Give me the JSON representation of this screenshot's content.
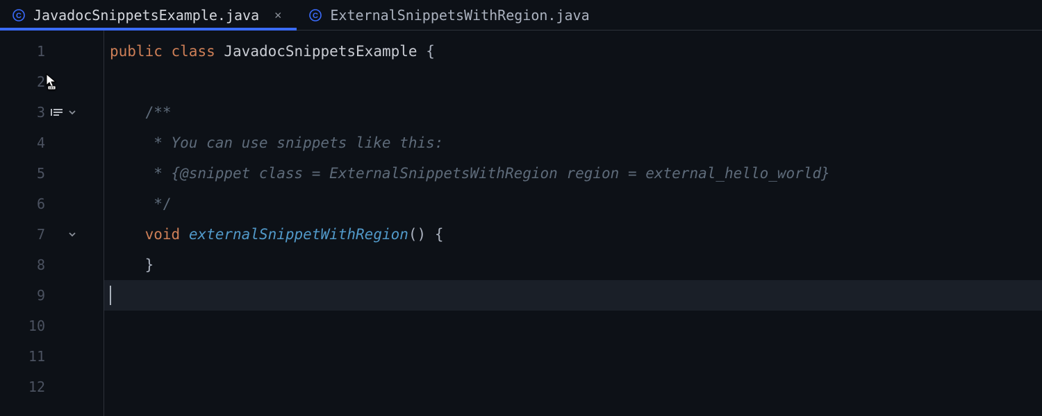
{
  "tabs": [
    {
      "label": "JavadocSnippetsExample.java",
      "active": true,
      "closable": true
    },
    {
      "label": "ExternalSnippetsWithRegion.java",
      "active": false,
      "closable": false
    }
  ],
  "gutter": {
    "lines": [
      "1",
      "2",
      "3",
      "4",
      "5",
      "6",
      "7",
      "8",
      "9",
      "10",
      "11",
      "12"
    ],
    "fold_at": [
      3,
      7
    ],
    "render_icon_at": 3,
    "current_line": 9
  },
  "code": {
    "l1": {
      "kw1": "public",
      "kw2": "class",
      "cls": "JavadocSnippetsExample",
      "brace": " {"
    },
    "l2": "",
    "l3": "    /**",
    "l4": "     * You can use snippets like this:",
    "l5": "     * {@snippet class = ExternalSnippetsWithRegion region = external_hello_world}",
    "l6": "     */",
    "l7": {
      "indent": "    ",
      "kw": "void",
      "fn": "externalSnippetWithRegion",
      "rest": "() {"
    },
    "l8": "    }",
    "l9": ""
  },
  "icons": {
    "class_circle": "class-icon",
    "close": "close-icon",
    "chevron_down": "chevron-down-icon",
    "doc_render": "doc-render-icon"
  }
}
